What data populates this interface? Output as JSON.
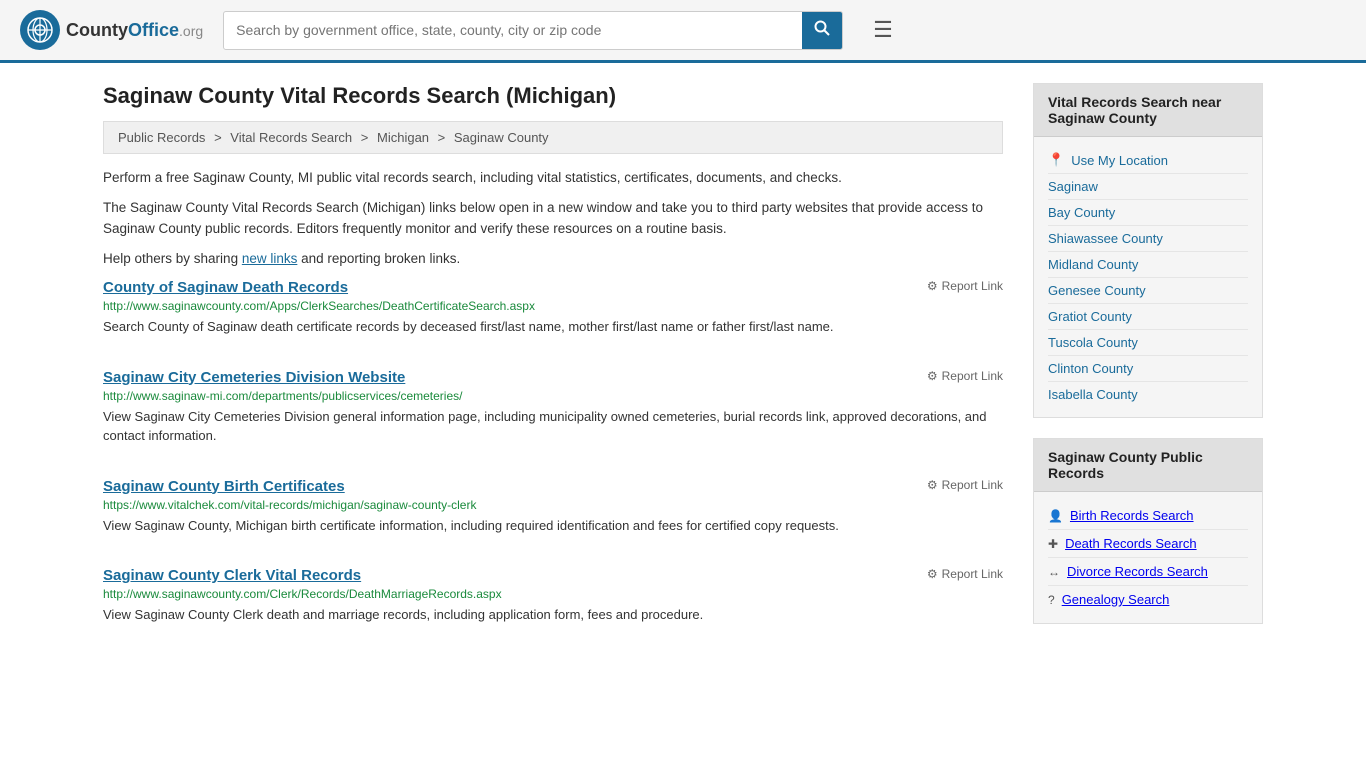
{
  "header": {
    "logo_text": "CountyOffice",
    "logo_org": ".org",
    "search_placeholder": "Search by government office, state, county, city or zip code",
    "menu_icon": "☰"
  },
  "page": {
    "title": "Saginaw County Vital Records Search (Michigan)",
    "breadcrumb": {
      "items": [
        "Public Records",
        "Vital Records Search",
        "Michigan",
        "Saginaw County"
      ]
    },
    "description1": "Perform a free Saginaw County, MI public vital records search, including vital statistics, certificates, documents, and checks.",
    "description2": "The Saginaw County Vital Records Search (Michigan) links below open in a new window and take you to third party websites that provide access to Saginaw County public records. Editors frequently monitor and verify these resources on a routine basis.",
    "description3_pre": "Help others by sharing ",
    "description3_link": "new links",
    "description3_post": " and reporting broken links."
  },
  "results": [
    {
      "title": "County of Saginaw Death Records",
      "url": "http://www.saginawcounty.com/Apps/ClerkSearches/DeathCertificateSearch.aspx",
      "description": "Search County of Saginaw death certificate records by deceased first/last name, mother first/last name or father first/last name.",
      "report_label": "Report Link"
    },
    {
      "title": "Saginaw City Cemeteries Division Website",
      "url": "http://www.saginaw-mi.com/departments/publicservices/cemeteries/",
      "description": "View Saginaw City Cemeteries Division general information page, including municipality owned cemeteries, burial records link, approved decorations, and contact information.",
      "report_label": "Report Link"
    },
    {
      "title": "Saginaw County Birth Certificates",
      "url": "https://www.vitalchek.com/vital-records/michigan/saginaw-county-clerk",
      "description": "View Saginaw County, Michigan birth certificate information, including required identification and fees for certified copy requests.",
      "report_label": "Report Link"
    },
    {
      "title": "Saginaw County Clerk Vital Records",
      "url": "http://www.saginawcounty.com/Clerk/Records/DeathMarriageRecords.aspx",
      "description": "View Saginaw County Clerk death and marriage records, including application form, fees and procedure.",
      "report_label": "Report Link"
    }
  ],
  "sidebar": {
    "nearby_title": "Vital Records Search near Saginaw County",
    "use_location_label": "Use My Location",
    "nearby_items": [
      {
        "label": "Saginaw"
      },
      {
        "label": "Bay County"
      },
      {
        "label": "Shiawassee County"
      },
      {
        "label": "Midland County"
      },
      {
        "label": "Genesee County"
      },
      {
        "label": "Gratiot County"
      },
      {
        "label": "Tuscola County"
      },
      {
        "label": "Clinton County"
      },
      {
        "label": "Isabella County"
      }
    ],
    "public_records_title": "Saginaw County Public Records",
    "public_records_items": [
      {
        "label": "Birth Records Search",
        "icon": "👤"
      },
      {
        "label": "Death Records Search",
        "icon": "✚"
      },
      {
        "label": "Divorce Records Search",
        "icon": "↔"
      },
      {
        "label": "Genealogy Search",
        "icon": "?"
      }
    ]
  }
}
